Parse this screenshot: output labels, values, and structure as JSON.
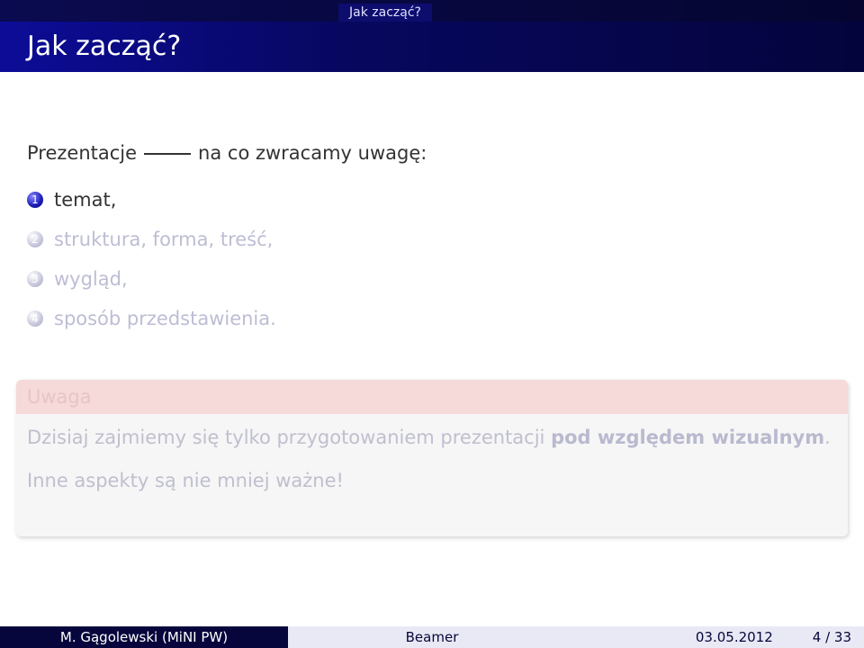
{
  "headline": {
    "section": "Jak zacząć?"
  },
  "frame": {
    "title": "Jak zacząć?"
  },
  "intro": {
    "left": "Prezentacje",
    "right": "na co zwracamy uwagę:"
  },
  "items": [
    {
      "num": "1",
      "text": "temat,",
      "active": true
    },
    {
      "num": "2",
      "text": "struktura, forma, treść,",
      "active": false
    },
    {
      "num": "3",
      "text": "wygląd,",
      "active": false
    },
    {
      "num": "4",
      "text": "sposób przedstawienia.",
      "active": false
    }
  ],
  "alert": {
    "title": "Uwaga",
    "line1_plain": "Dzisiaj zajmiemy się tylko przygotowaniem prezentacji ",
    "line1_bold": "pod względem wizualnym",
    "line1_end": ".",
    "line2": "Inne aspekty są nie mniej ważne!"
  },
  "footer": {
    "author": "M. Gągolewski  (MiNI PW)",
    "title": "Beamer",
    "date": "03.05.2012",
    "page": "4 / 33"
  },
  "colors": {
    "headline_bg": "#0a0a50",
    "frametitle_bg": "#0c0c98",
    "alert_head_bg": "#f6d9d9",
    "footer_dark": "#06063c",
    "footer_light": "#e9e9f5"
  }
}
